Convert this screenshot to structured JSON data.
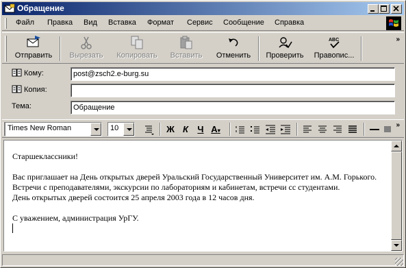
{
  "window": {
    "title": "Обращение"
  },
  "menu": [
    {
      "label": "Файл"
    },
    {
      "label": "Правка"
    },
    {
      "label": "Вид"
    },
    {
      "label": "Вставка"
    },
    {
      "label": "Формат"
    },
    {
      "label": "Сервис"
    },
    {
      "label": "Сообщение"
    },
    {
      "label": "Справка"
    }
  ],
  "toolbar": {
    "send": "Отправить",
    "cut": "Вырезать",
    "copy": "Копировать",
    "paste": "Вставить",
    "undo": "Отменить",
    "check": "Проверить",
    "spelling": "Правопис..."
  },
  "headers": {
    "to_label": "Кому:",
    "to_value": "post@zsch2.e-burg.su",
    "cc_label": "Копия:",
    "cc_value": "",
    "subject_label": "Тема:",
    "subject_value": "Обращение"
  },
  "format": {
    "font": "Times New Roman",
    "size": "10",
    "bold": "Ж",
    "italic": "К",
    "underline": "Ч",
    "color": "A"
  },
  "body": {
    "greeting": "Старшеклассники!",
    "p1": "Вас приглашает на День открытых дверей Уральский Государственный Университет им. А.М. Горького. Встречи с преподавателями, экскурсии по лабораториям и кабинетам, встречи сс студентами.",
    "p2": "День открытых дверей состоится 25 апреля 2003 года в 12 часов дня.",
    "closing": "С уважением, администрация УрГУ."
  }
}
